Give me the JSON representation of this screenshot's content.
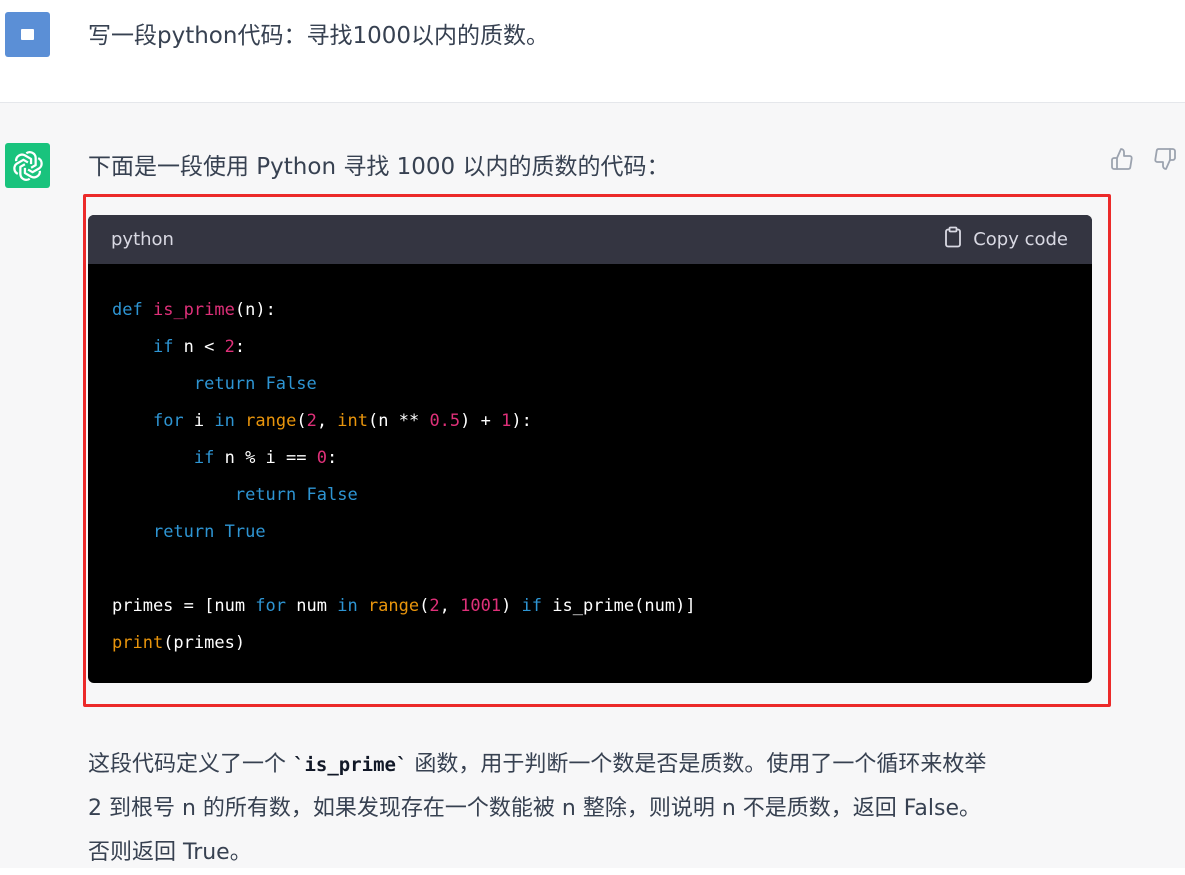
{
  "user_message": {
    "text": "写一段python代码：寻找1000以内的质数。"
  },
  "assistant": {
    "intro": "下面是一段使用 Python 寻找 1000 以内的质数的代码：",
    "code_block": {
      "language": "python",
      "copy_label": "Copy code",
      "lines": [
        [
          {
            "t": "def",
            "c": "kw"
          },
          {
            "t": " ",
            "c": "txt"
          },
          {
            "t": "is_prime",
            "c": "fn"
          },
          {
            "t": "(n):",
            "c": "txt"
          }
        ],
        [
          {
            "t": "    ",
            "c": "txt"
          },
          {
            "t": "if",
            "c": "kw"
          },
          {
            "t": " n < ",
            "c": "txt"
          },
          {
            "t": "2",
            "c": "num"
          },
          {
            "t": ":",
            "c": "txt"
          }
        ],
        [
          {
            "t": "        ",
            "c": "txt"
          },
          {
            "t": "return",
            "c": "kw"
          },
          {
            "t": " ",
            "c": "txt"
          },
          {
            "t": "False",
            "c": "kw"
          }
        ],
        [
          {
            "t": "    ",
            "c": "txt"
          },
          {
            "t": "for",
            "c": "kw"
          },
          {
            "t": " i ",
            "c": "txt"
          },
          {
            "t": "in",
            "c": "kw"
          },
          {
            "t": " ",
            "c": "txt"
          },
          {
            "t": "range",
            "c": "bi"
          },
          {
            "t": "(",
            "c": "txt"
          },
          {
            "t": "2",
            "c": "num"
          },
          {
            "t": ", ",
            "c": "txt"
          },
          {
            "t": "int",
            "c": "bi"
          },
          {
            "t": "(n ** ",
            "c": "txt"
          },
          {
            "t": "0.5",
            "c": "num"
          },
          {
            "t": ") + ",
            "c": "txt"
          },
          {
            "t": "1",
            "c": "num"
          },
          {
            "t": "):",
            "c": "txt"
          }
        ],
        [
          {
            "t": "        ",
            "c": "txt"
          },
          {
            "t": "if",
            "c": "kw"
          },
          {
            "t": " n % i == ",
            "c": "txt"
          },
          {
            "t": "0",
            "c": "num"
          },
          {
            "t": ":",
            "c": "txt"
          }
        ],
        [
          {
            "t": "            ",
            "c": "txt"
          },
          {
            "t": "return",
            "c": "kw"
          },
          {
            "t": " ",
            "c": "txt"
          },
          {
            "t": "False",
            "c": "kw"
          }
        ],
        [
          {
            "t": "    ",
            "c": "txt"
          },
          {
            "t": "return",
            "c": "kw"
          },
          {
            "t": " ",
            "c": "txt"
          },
          {
            "t": "True",
            "c": "kw"
          }
        ],
        [],
        [
          {
            "t": "primes = [num ",
            "c": "txt"
          },
          {
            "t": "for",
            "c": "kw"
          },
          {
            "t": " num ",
            "c": "txt"
          },
          {
            "t": "in",
            "c": "kw"
          },
          {
            "t": " ",
            "c": "txt"
          },
          {
            "t": "range",
            "c": "bi"
          },
          {
            "t": "(",
            "c": "txt"
          },
          {
            "t": "2",
            "c": "num"
          },
          {
            "t": ", ",
            "c": "txt"
          },
          {
            "t": "1001",
            "c": "num"
          },
          {
            "t": ") ",
            "c": "txt"
          },
          {
            "t": "if",
            "c": "kw"
          },
          {
            "t": " is_prime(num)]",
            "c": "txt"
          }
        ],
        [
          {
            "t": "print",
            "c": "bi"
          },
          {
            "t": "(primes)",
            "c": "txt"
          }
        ]
      ]
    },
    "explanation": {
      "line1_pre": "这段代码定义了一个 ",
      "line1_code": "`is_prime`",
      "line1_post": " 函数，用于判断一个数是否是质数。使用了一个循环来枚举",
      "line2": "2 到根号 n 的所有数，如果发现存在一个数能被 n 整除，则说明 n 不是质数，返回 False。",
      "line3": "否则返回 True。"
    }
  },
  "colors": {
    "keyword": "#2e95d3",
    "function_number": "#df3079",
    "builtin": "#e9950c",
    "highlight_border": "#ec2a2a",
    "gpt_avatar": "#19c37d"
  },
  "icons": [
    "user-avatar-icon",
    "chatgpt-logo-icon",
    "thumbs-up-icon",
    "thumbs-down-icon",
    "clipboard-icon"
  ]
}
